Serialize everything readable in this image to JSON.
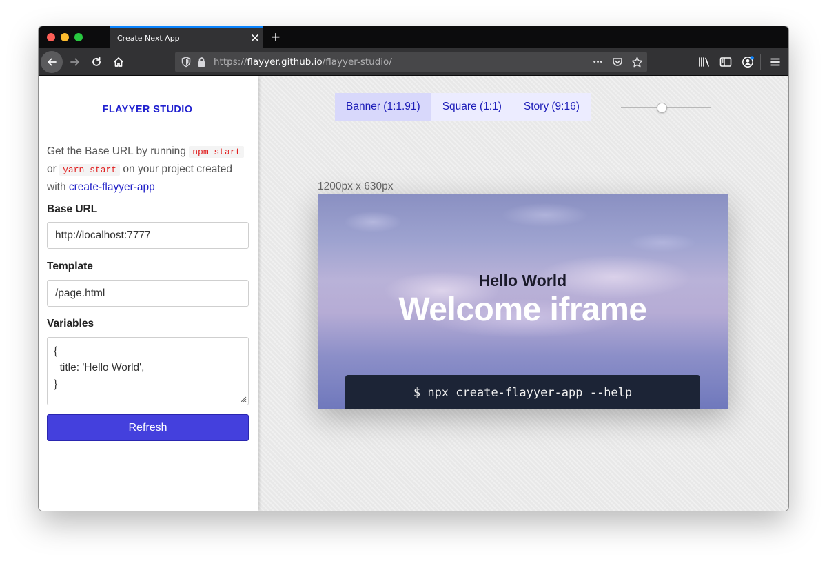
{
  "browser": {
    "tab_title": "Create Next App",
    "tab_close": "✕",
    "new_tab": "+",
    "url_prefix": "https://",
    "url_host": "flayyer.github.io",
    "url_path": "/flayyer-studio/",
    "url_more": "•••",
    "accent_color": "#0a84ff"
  },
  "sidebar": {
    "brand": "FLAYYER STUDIO",
    "help": {
      "text_1": "Get the Base URL by running ",
      "code_1": "npm start",
      "text_2": " or ",
      "code_2": "yarn start",
      "text_3": " on your project created with ",
      "link": "create-flayyer-app"
    },
    "base_url_label": "Base URL",
    "base_url_value": "http://localhost:7777",
    "template_label": "Template",
    "template_value": "/page.html",
    "variables_label": "Variables",
    "variables_value": "{\n  title: 'Hello World',\n}",
    "refresh_label": "Refresh",
    "brand_color": "#2020cf",
    "button_color": "#4440dd"
  },
  "canvas": {
    "format_tabs": [
      {
        "label": "Banner (1:1.91)",
        "active": true
      },
      {
        "label": "Square (1:1)",
        "active": false
      },
      {
        "label": "Story (9:16)",
        "active": false
      }
    ],
    "zoom_level": 0.45,
    "dimensions": "1200px x 630px",
    "preview": {
      "subtitle": "Hello World",
      "title": "Welcome iframe",
      "command": "$ npx create-flayyer-app --help"
    }
  }
}
